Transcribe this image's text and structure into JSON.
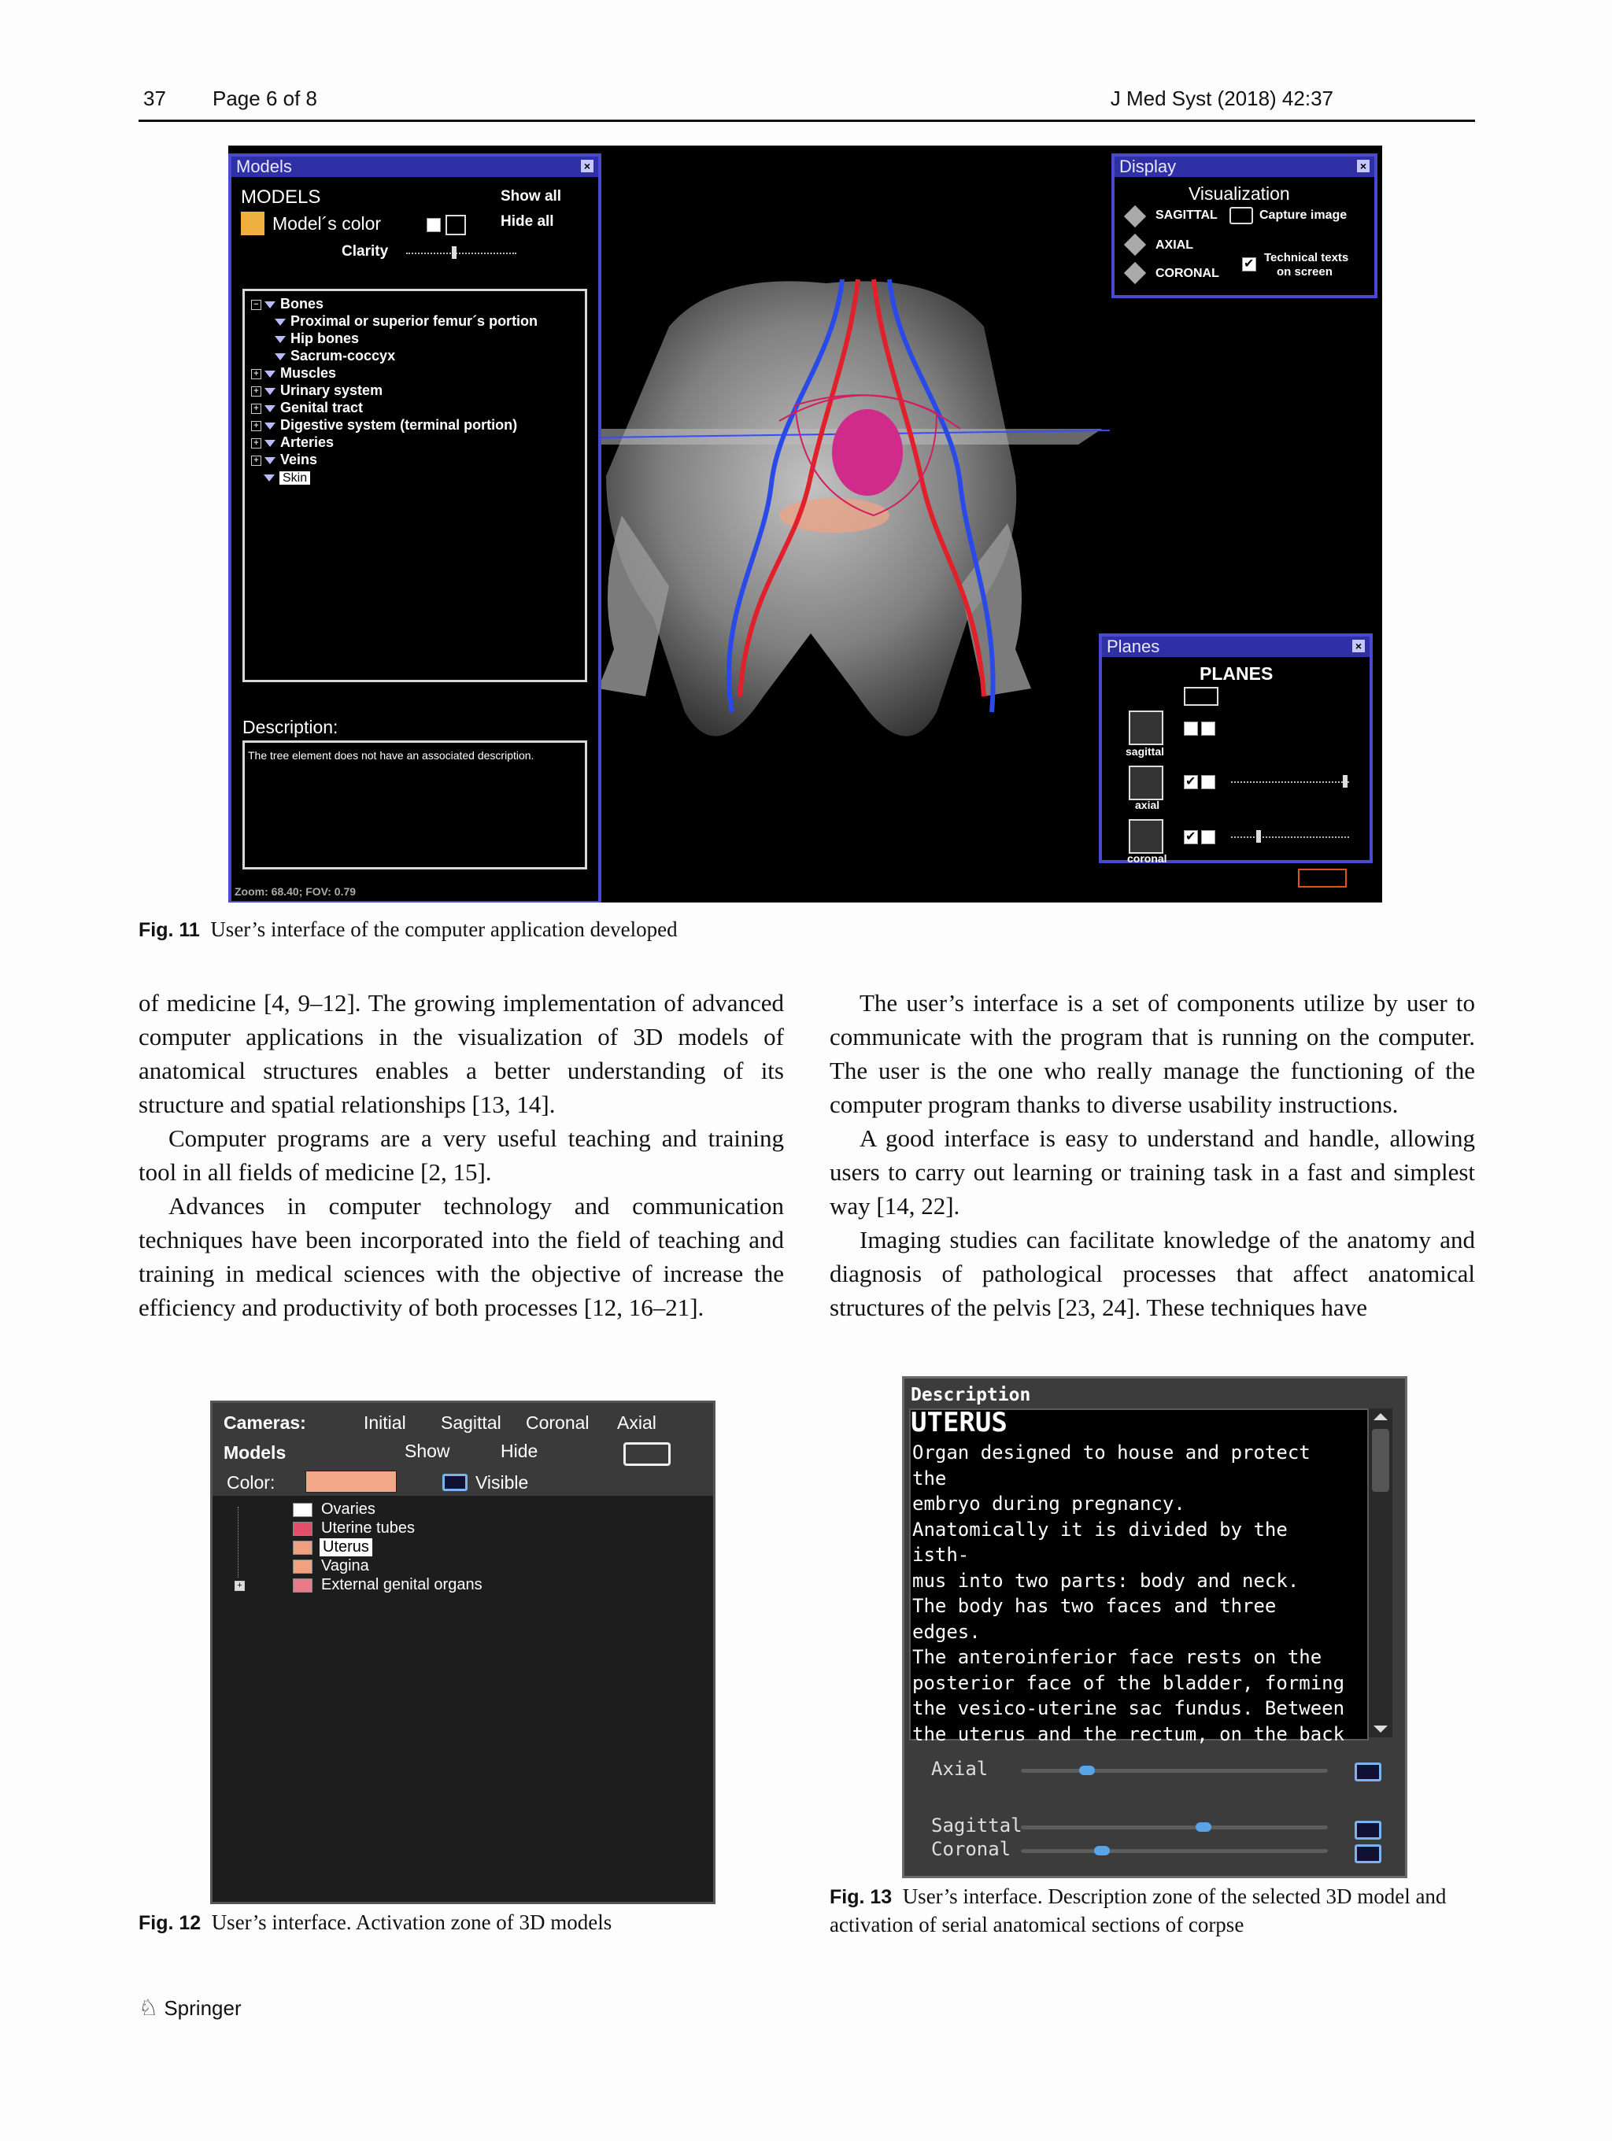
{
  "header": {
    "page_num": "37",
    "page_of": "Page 6 of 8",
    "journal": "J Med Syst  (2018) 42:37"
  },
  "fig11": {
    "models_panel": {
      "title": "Models",
      "heading": "MODELS",
      "show_all": "Show all",
      "color_label": "Model´s color",
      "hide_all": "Hide all",
      "clarity": "Clarity",
      "tree": [
        "Bones",
        "Proximal or superior femur´s portion",
        "Hip bones",
        "Sacrum-coccyx",
        "Muscles",
        "Urinary system",
        "Genital tract",
        "Digestive system (terminal portion)",
        "Arteries",
        "Veins",
        "Skin"
      ],
      "description_label": "Description:",
      "description_text": "The tree element does not have an associated description.",
      "zoom": "Zoom: 68.40; FOV: 0.79"
    },
    "display_panel": {
      "title": "Display",
      "heading": "Visualization",
      "sagittal": "SAGITTAL",
      "capture": "Capture image",
      "axial": "AXIAL",
      "coronal": "CORONAL",
      "technical": "Technical texts",
      "technical2": "on screen"
    },
    "planes_panel": {
      "title": "Planes",
      "heading": "PLANES",
      "sagittal": "sagittal",
      "axial": "axial",
      "coronal": "coronal"
    }
  },
  "caption11": {
    "label": "Fig. 11",
    "text": "User’s interface of the computer application developed"
  },
  "left_col": [
    "of medicine [4, 9–12]. The growing implementation of advanced computer applications in the visualization of 3D models of anatomical structures enables a better understanding of its structure and spatial relationships [13, 14].",
    "Computer programs are a very useful teaching and training tool in all fields of medicine [2, 15].",
    "Advances in computer technology and communication techniques have been incorporated into the field of teaching and training in medical sciences with the objective of increase the efficiency and productivity of both processes [12, 16–21]."
  ],
  "right_col": [
    "The user’s interface is a set of components utilize by user to communicate with the program that is running on the computer. The user is the one who really manage the functioning of the computer program thanks to diverse usability instructions.",
    "A good interface is easy to understand and handle, allowing users to carry out learning or training task in a fast and simplest way [14, 22].",
    "Imaging studies can facilitate knowledge of the anatomy and diagnosis of pathological processes that affect anatomical structures of the pelvis [23, 24]. These techniques have"
  ],
  "fig12": {
    "cameras": "Cameras:",
    "initial": "Initial",
    "sagittal": "Sagittal",
    "coronal": "Coronal",
    "axial": "Axial",
    "models": "Models",
    "show": "Show",
    "hide": "Hide",
    "color": "Color:",
    "visible": "Visible",
    "items": [
      "Ovaries",
      "Uterine tubes",
      "Uterus",
      "Vagina",
      "External genital organs"
    ],
    "item_colors": [
      "#ffffff",
      "#e0506a",
      "#f0a080",
      "#f2a080",
      "#e87a8a"
    ],
    "color_value": "#f4a88a"
  },
  "caption12": {
    "label": "Fig. 12",
    "text": "User’s interface. Activation zone of 3D models"
  },
  "fig13": {
    "description": "Description",
    "title": "UTERUS",
    "body_lines": [
      "Organ designed to house and protect the",
      "embryo during pregnancy.",
      "Anatomically it is divided by the isth-",
      "mus into two parts: body and neck.",
      "The body has two faces and three edges.",
      "The anteroinferior face rests on the",
      "posterior face of the bladder, forming",
      "the vesico-uterine sac fundus. Between",
      "the uterus and the rectum, on the back"
    ],
    "sliders": [
      {
        "label": "Axial",
        "value": 0.2
      },
      {
        "label": "Sagittal",
        "value": 0.6
      },
      {
        "label": "Coronal",
        "value": 0.25
      }
    ]
  },
  "caption13": {
    "label": "Fig. 13",
    "text": "User’s interface. Description zone of the selected 3D model and activation of serial anatomical sections of corpse"
  },
  "footer": {
    "publisher": "Springer"
  }
}
